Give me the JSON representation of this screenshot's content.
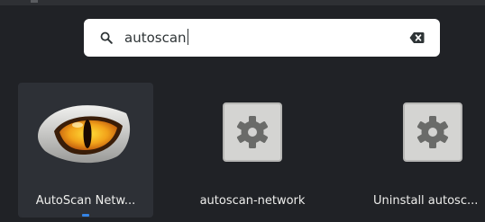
{
  "search": {
    "query": "autoscan",
    "search_icon": "search-icon",
    "clear_icon": "backspace-clear-icon"
  },
  "results": [
    {
      "label": "AutoScan Netw...",
      "icon": "cat-eye-app-icon",
      "selected": true,
      "running": true
    },
    {
      "label": "autoscan-network",
      "icon": "gear-icon",
      "selected": false,
      "running": false
    },
    {
      "label": "Uninstall autosc...",
      "icon": "gear-icon",
      "selected": false,
      "running": false
    }
  ],
  "colors": {
    "background": "#202226",
    "selected_tile": "#2d3036",
    "running_indicator": "#3584e4",
    "text": "#eeeeec"
  }
}
